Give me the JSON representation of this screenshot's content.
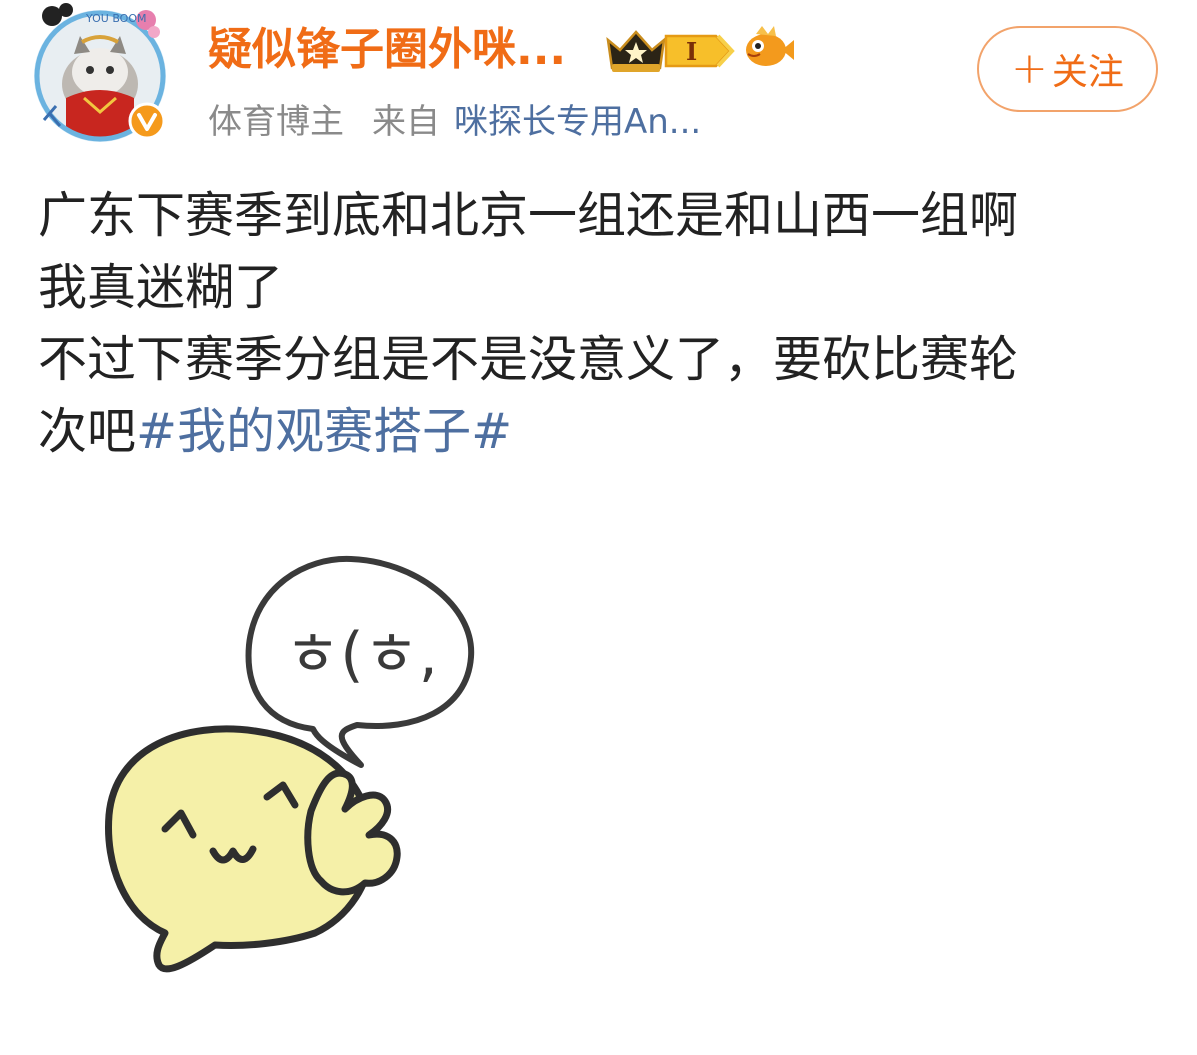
{
  "header": {
    "username": "疑似锋子圈外咪...",
    "level_badge": "I",
    "verified_label": "体育博主",
    "from_label": "来自",
    "source": "咪探长专用An...",
    "follow_label": "关注",
    "avatar_text": "YOU BOOM"
  },
  "post": {
    "lines": [
      "广东下赛季到底和北京一组还是和山西一组啊",
      "我真迷糊了",
      "不过下赛季分组是不是没意义了，要砍比赛轮",
      "次吧"
    ],
    "topic": "#我的观赛搭子#",
    "sticker_text": "ㅎ(ㅎ,"
  },
  "icons": {
    "avatar": "avatar-icon",
    "verified": "verified-icon",
    "crown": "crown-badge-icon",
    "level": "level-badge-icon",
    "fish": "fish-badge-icon",
    "plus": "plus-icon"
  },
  "colors": {
    "username": "#f06c16",
    "link": "#4e6fa0",
    "text": "#222222",
    "meta": "#8a8a8a",
    "sticker_fill": "#f5f0a8",
    "verified": "#f59a1c"
  }
}
